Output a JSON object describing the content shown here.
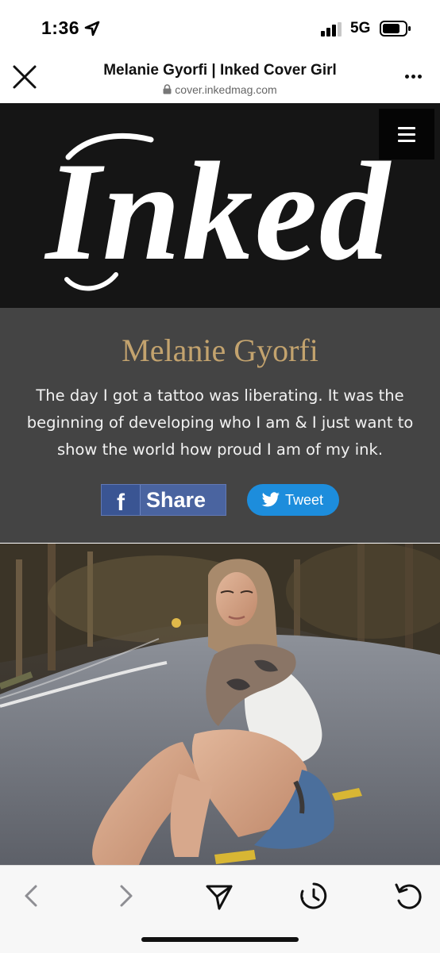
{
  "status_bar": {
    "time": "1:36",
    "network": "5G"
  },
  "browser": {
    "title": "Melanie Gyorfi | Inked Cover Girl",
    "url": "cover.inkedmag.com"
  },
  "site": {
    "logo_text": "Inked"
  },
  "hero": {
    "name": "Melanie Gyorfi",
    "quote_lines": [
      "The day I got a tattoo was liberating. It was the",
      "beginning of developing who I am & I just want to",
      "show the world how proud I am of my ink."
    ],
    "share_label": "Share",
    "share_icon_letter": "f",
    "tweet_label": "Tweet"
  },
  "colors": {
    "header_bg": "#151515",
    "hero_bg": "#444444",
    "name_gold": "#c3a36e",
    "facebook_blue": "#4a64a0",
    "twitter_blue": "#1d8ddc"
  },
  "icons": {
    "close": "close-icon",
    "lock": "lock-icon",
    "more": "more-icon",
    "menu": "hamburger-icon",
    "back": "chevron-left-icon",
    "forward": "chevron-right-icon",
    "share": "send-icon",
    "history": "history-icon",
    "reload": "reload-icon"
  }
}
